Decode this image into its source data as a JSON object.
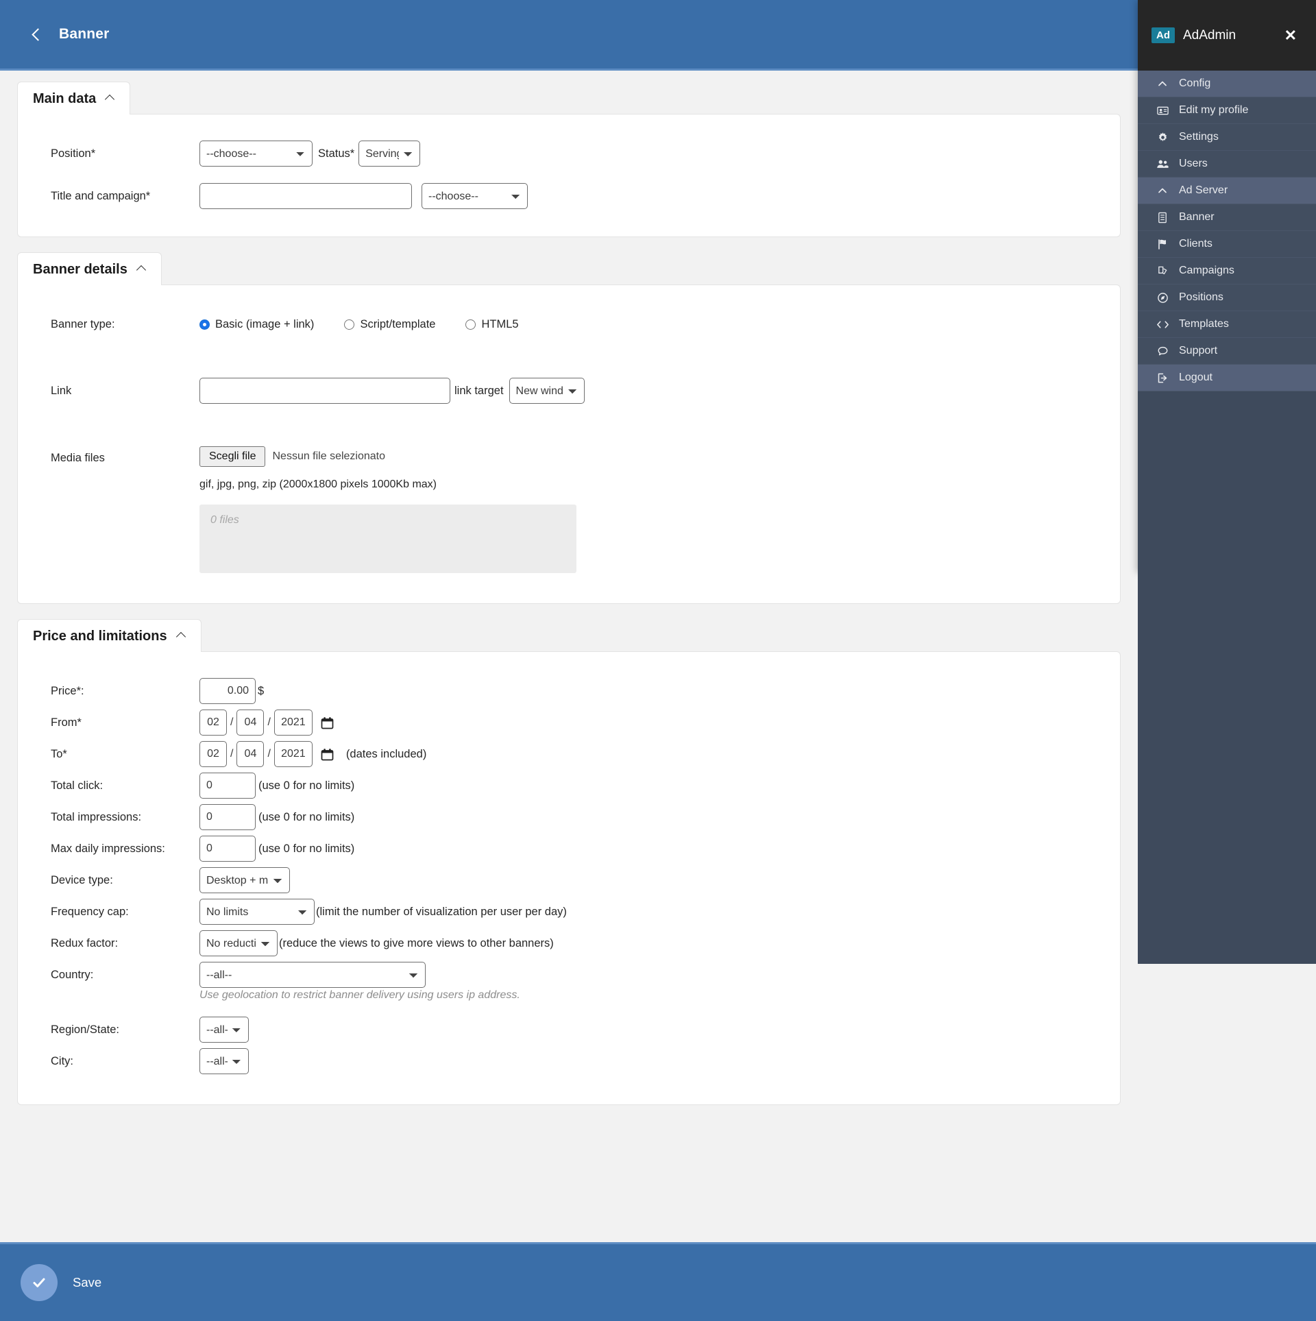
{
  "header": {
    "title": "Banner",
    "back_icon": "chevron-left-icon"
  },
  "sections": {
    "main_data": {
      "title": "Main data",
      "fields": {
        "position_label": "Position*",
        "position_value": "--choose--",
        "status_label": "Status*",
        "status_value": "Serving",
        "title_campaign_label": "Title and campaign*",
        "title_value": "",
        "campaign_value": "--choose--"
      }
    },
    "banner_details": {
      "title": "Banner details",
      "fields": {
        "banner_type_label": "Banner type:",
        "type_options": [
          {
            "label": "Basic (image + link)",
            "selected": true
          },
          {
            "label": "Script/template",
            "selected": false
          },
          {
            "label": "HTML5",
            "selected": false
          }
        ],
        "link_label": "Link",
        "link_value": "",
        "link_target_label": "link target",
        "link_target_value": "New window",
        "media_files_label": "Media files",
        "file_button": "Scegli file",
        "file_status": "Nessun file selezionato",
        "file_hint": "gif, jpg, png, zip (2000x1800 pixels 1000Kb max)",
        "dropzone_text": "0 files"
      }
    },
    "price_limits": {
      "title": "Price and limitations",
      "fields": {
        "price_label": "Price*:",
        "price_value": "0.00",
        "currency": "$",
        "from_label": "From*",
        "from_day": "02",
        "from_month": "04",
        "from_year": "2021",
        "to_label": "To*",
        "to_day": "02",
        "to_month": "04",
        "to_year": "2021",
        "dates_included_note": "(dates included)",
        "total_click_label": "Total click:",
        "total_click_value": "0",
        "total_impressions_label": "Total impressions:",
        "total_impressions_value": "0",
        "max_daily_label": "Max daily impressions:",
        "max_daily_value": "0",
        "no_limits_note": "(use 0 for no limits)",
        "device_type_label": "Device type:",
        "device_type_value": "Desktop + mobile",
        "frequency_cap_label": "Frequency cap:",
        "frequency_cap_value": "No limits",
        "frequency_cap_note": "(limit the number of visualization per user per day)",
        "redux_factor_label": "Redux factor:",
        "redux_factor_value": "No reduction",
        "redux_factor_note": "(reduce the views to give more views to other banners)",
        "country_label": "Country:",
        "country_value": "--all--",
        "geolocation_note": "Use geolocation to restrict banner delivery using users ip address.",
        "region_label": "Region/State:",
        "region_value": "--all--",
        "city_label": "City:",
        "city_value": "--all--"
      }
    }
  },
  "footer": {
    "save_label": "Save",
    "save_icon": "check-icon"
  },
  "drawer": {
    "badge": "Ad",
    "title": "AdAdmin",
    "close_icon": "close-icon",
    "items": [
      {
        "label": "Config",
        "icon": "chevron-up-icon",
        "kind": "group"
      },
      {
        "label": "Edit my profile",
        "icon": "id-card-icon",
        "kind": "sub"
      },
      {
        "label": "Settings",
        "icon": "gear-icon",
        "kind": "sub"
      },
      {
        "label": "Users",
        "icon": "users-icon",
        "kind": "sub"
      },
      {
        "label": "Ad Server",
        "icon": "chevron-up-icon",
        "kind": "group"
      },
      {
        "label": "Banner",
        "icon": "document-icon",
        "kind": "sub"
      },
      {
        "label": "Clients",
        "icon": "flag-icon",
        "kind": "sub"
      },
      {
        "label": "Campaigns",
        "icon": "layers-icon",
        "kind": "sub"
      },
      {
        "label": "Positions",
        "icon": "compass-icon",
        "kind": "sub"
      },
      {
        "label": "Templates",
        "icon": "code-icon",
        "kind": "sub"
      },
      {
        "label": "Support",
        "icon": "chat-icon",
        "kind": "sub"
      },
      {
        "label": "Logout",
        "icon": "logout-icon",
        "kind": "group"
      }
    ]
  },
  "colors": {
    "accent_blue": "#3a6ea8",
    "drawer_bg": "#3e4a5c",
    "drawer_head_bg": "#262626",
    "badge_teal": "#1a7d99",
    "radio_blue": "#1a73e8"
  }
}
